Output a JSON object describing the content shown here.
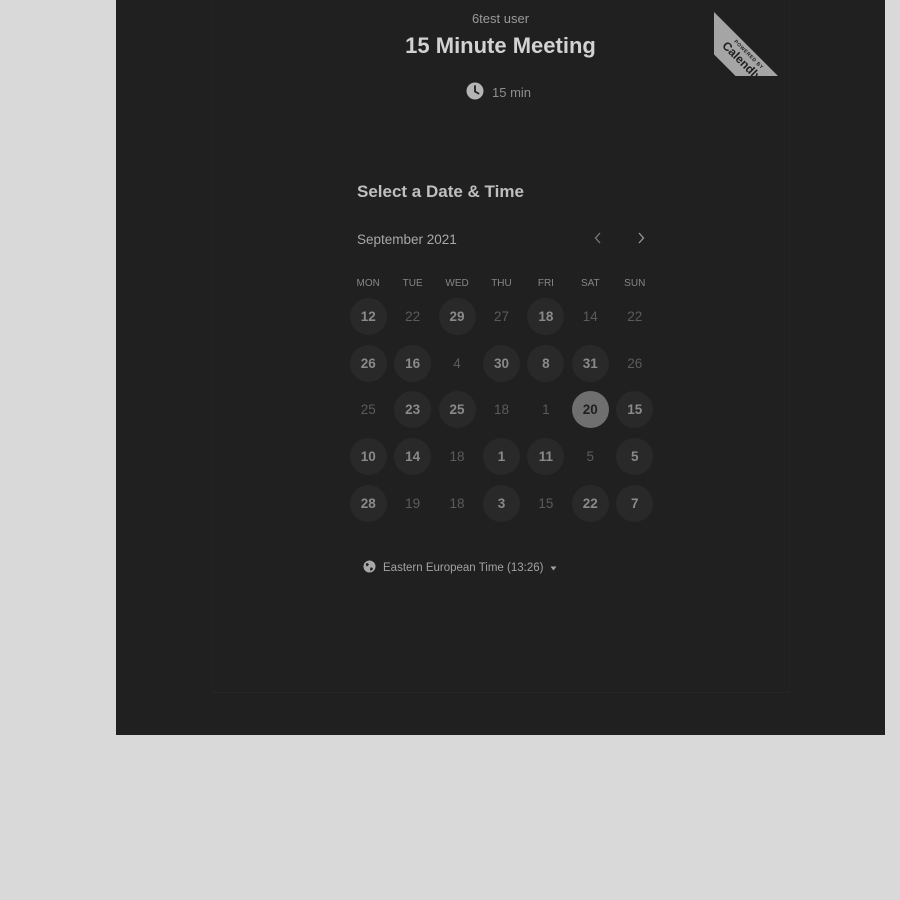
{
  "ribbon": {
    "small": "POWERED BY",
    "brand": "Calendly"
  },
  "header": {
    "host_name": "6test user",
    "event_title": "15 Minute Meeting",
    "duration": "15 min",
    "duration_icon": "clock-icon"
  },
  "calendar": {
    "section_title": "Select a Date & Time",
    "month_label": "September 2021",
    "prev_icon": "chevron-left-icon",
    "next_icon": "chevron-right-icon",
    "weekdays": [
      "MON",
      "TUE",
      "WED",
      "THU",
      "FRI",
      "SAT",
      "SUN"
    ],
    "weeks": [
      [
        {
          "d": "12",
          "s": "available"
        },
        {
          "d": "22",
          "s": "disabled"
        },
        {
          "d": "29",
          "s": "available"
        },
        {
          "d": "27",
          "s": "disabled"
        },
        {
          "d": "18",
          "s": "available"
        },
        {
          "d": "14",
          "s": "disabled"
        },
        {
          "d": "22",
          "s": "disabled"
        }
      ],
      [
        {
          "d": "26",
          "s": "available"
        },
        {
          "d": "16",
          "s": "available"
        },
        {
          "d": "4",
          "s": "disabled"
        },
        {
          "d": "30",
          "s": "available"
        },
        {
          "d": "8",
          "s": "available"
        },
        {
          "d": "31",
          "s": "available"
        },
        {
          "d": "26",
          "s": "disabled"
        }
      ],
      [
        {
          "d": "25",
          "s": "disabled"
        },
        {
          "d": "23",
          "s": "available"
        },
        {
          "d": "25",
          "s": "available"
        },
        {
          "d": "18",
          "s": "disabled"
        },
        {
          "d": "1",
          "s": "disabled"
        },
        {
          "d": "20",
          "s": "selected"
        },
        {
          "d": "15",
          "s": "available"
        }
      ],
      [
        {
          "d": "10",
          "s": "available"
        },
        {
          "d": "14",
          "s": "available"
        },
        {
          "d": "18",
          "s": "disabled"
        },
        {
          "d": "1",
          "s": "available"
        },
        {
          "d": "11",
          "s": "available"
        },
        {
          "d": "5",
          "s": "disabled"
        },
        {
          "d": "5",
          "s": "available"
        }
      ],
      [
        {
          "d": "28",
          "s": "available"
        },
        {
          "d": "19",
          "s": "disabled"
        },
        {
          "d": "18",
          "s": "disabled"
        },
        {
          "d": "3",
          "s": "available"
        },
        {
          "d": "15",
          "s": "disabled"
        },
        {
          "d": "22",
          "s": "available"
        },
        {
          "d": "7",
          "s": "available"
        }
      ]
    ]
  },
  "timezone": {
    "label": "Eastern European Time (13:26)",
    "icon": "globe-icon",
    "caret_icon": "caret-down-icon"
  }
}
